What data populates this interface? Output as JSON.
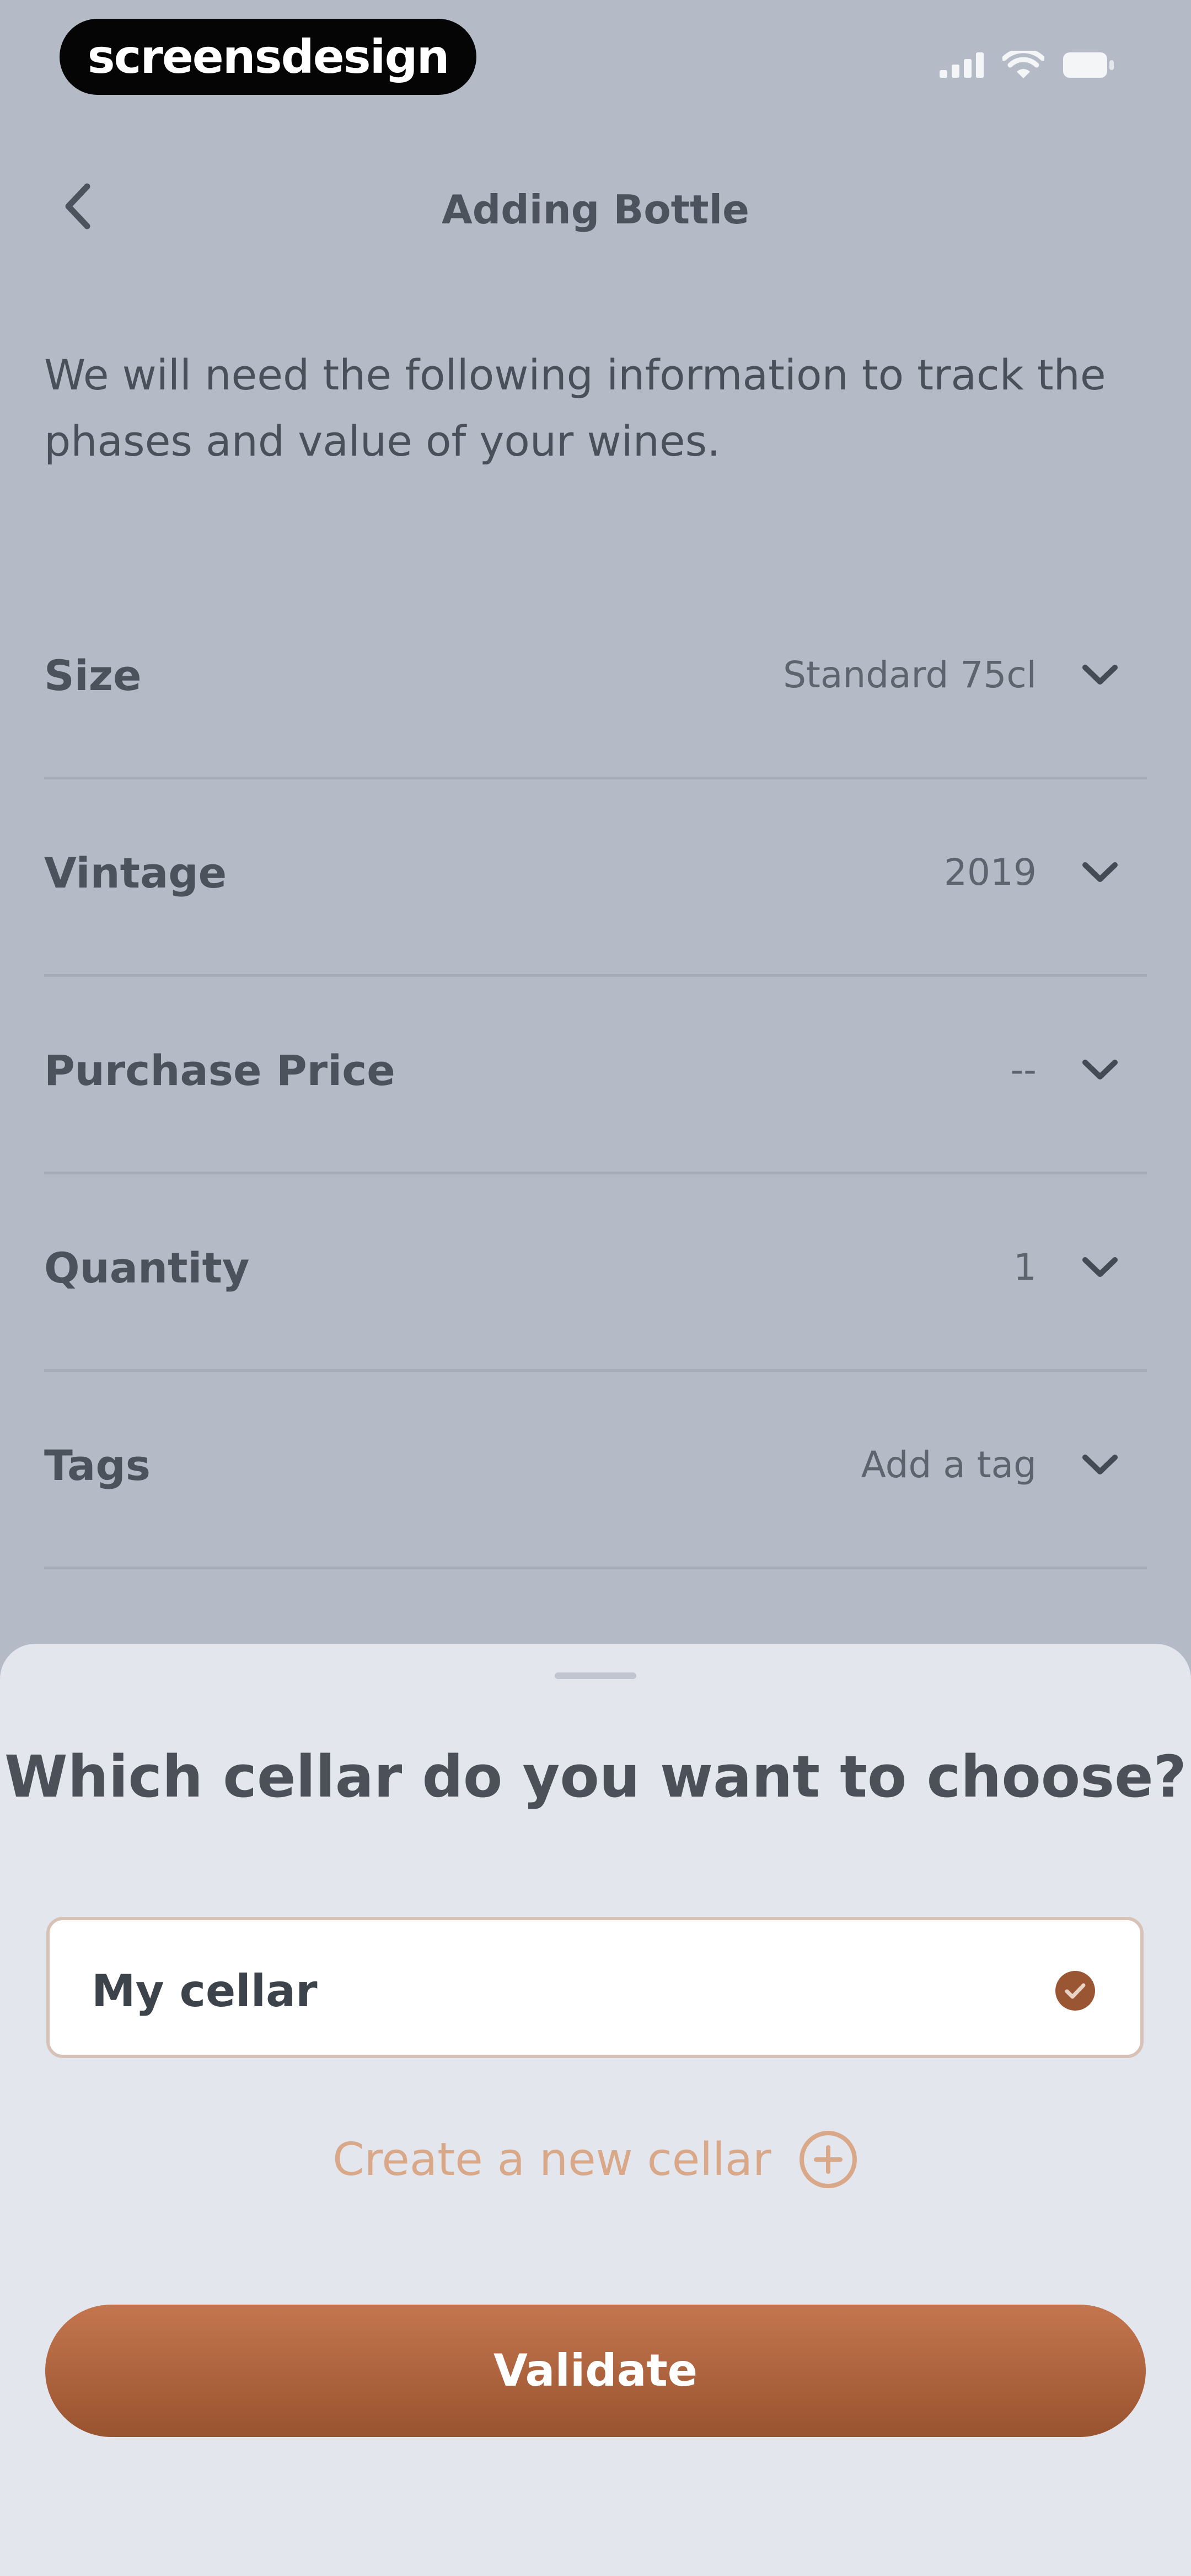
{
  "status_bar": {
    "brand": "screensdesign",
    "icons": [
      "signal-icon",
      "wifi-icon",
      "battery-icon"
    ]
  },
  "nav": {
    "title": "Adding Bottle",
    "back_icon": "chevron-left-icon"
  },
  "intro": "We will need the following information to track the phases and value of your wines.",
  "form": {
    "rows": [
      {
        "label": "Size",
        "value": "Standard 75cl"
      },
      {
        "label": "Vintage",
        "value": "2019"
      },
      {
        "label": "Purchase Price",
        "value": "--"
      },
      {
        "label": "Quantity",
        "value": "1"
      },
      {
        "label": "Tags",
        "value": "Add a tag"
      }
    ],
    "chevron_icon": "chevron-down-icon"
  },
  "sheet": {
    "title": "Which cellar do you want to choose?",
    "selected_cellar": "My cellar",
    "create_label": "Create a new cellar",
    "validate_label": "Validate"
  },
  "colors": {
    "accent": "#b2683f",
    "accent_light": "#d8a888",
    "overlay_background": "#b5bbc6",
    "sheet_background": "#e4e6ee"
  }
}
